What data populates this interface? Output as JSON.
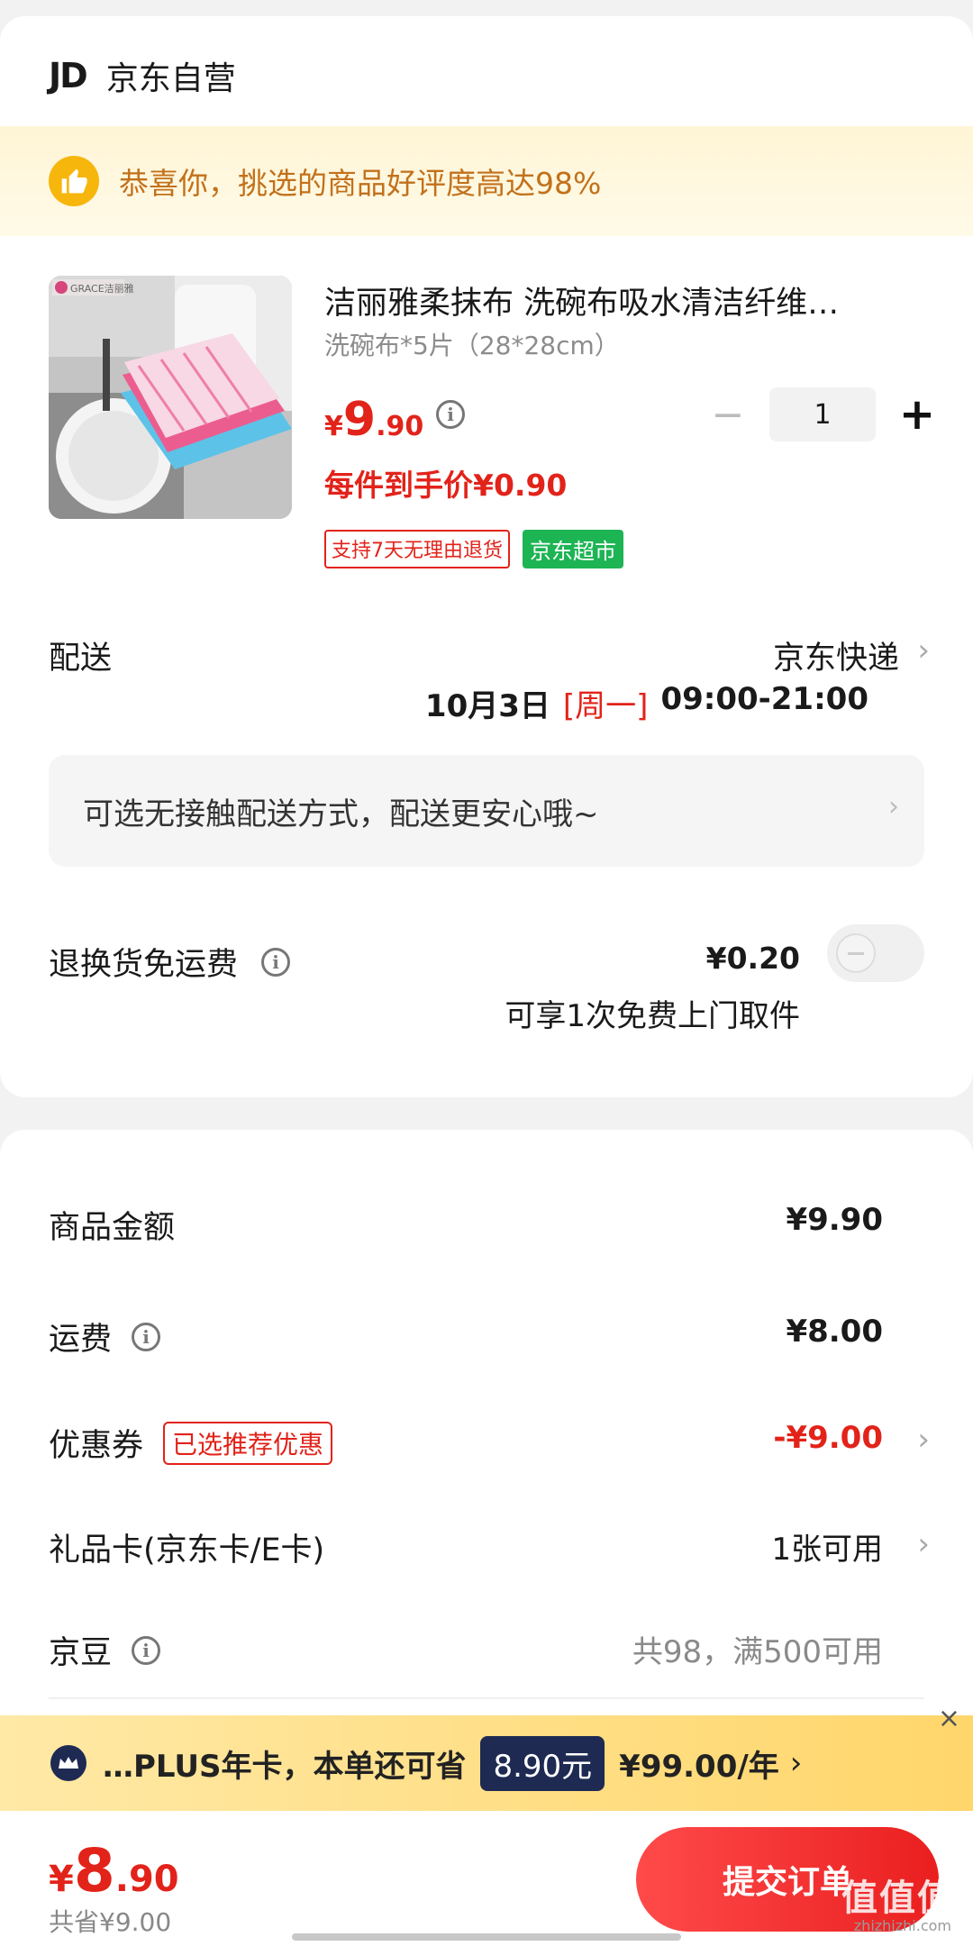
{
  "shop": {
    "logo": "JD",
    "name": "京东自营"
  },
  "praise": {
    "text": "恭喜你，挑选的商品好评度高达98%",
    "icon": "thumbs-up-icon"
  },
  "product": {
    "title": "洁丽雅柔抹布 洗碗布吸水清洁纤维…",
    "spec": "洗碗布*5片（28*28cm）",
    "price_currency": "¥",
    "price_int": "9",
    "price_dec": ".90",
    "unit_price": "每件到手价¥0.90",
    "badges": [
      "支持7天无理由退货",
      "京东超市"
    ],
    "quantity": "1",
    "img_watermark": "GRACE洁丽雅"
  },
  "delivery": {
    "label": "配送",
    "method": "京东快递",
    "date": "10月3日",
    "weekday": "[周一]",
    "time": "09:00-21:00",
    "contactless": "可选无接触配送方式，配送更安心哦~"
  },
  "return_shipping": {
    "label": "退换货免运费",
    "price": "¥0.20",
    "sub": "可享1次免费上门取件",
    "toggle_on": false
  },
  "summary": {
    "goods_amount_label": "商品金额",
    "goods_amount": "¥9.90",
    "freight_label": "运费",
    "freight": "¥8.00",
    "coupon_label": "优惠券",
    "coupon_tag": "已选推荐优惠",
    "coupon_value": "-¥9.00",
    "giftcard_label": "礼品卡(京东卡/E卡)",
    "giftcard_value": "1张可用",
    "jingdou_label": "京豆",
    "jingdou_value": "共98，满500可用"
  },
  "plus": {
    "text": "…PLUS年卡，本单还可省",
    "save": "8.90元",
    "price": "¥99.00/年",
    "chevron": "›",
    "close": "×"
  },
  "bottom": {
    "total_currency": "¥",
    "total_int": "8",
    "total_dec": ".90",
    "saved": "共省¥9.00",
    "submit": "提交订单"
  },
  "watermark": {
    "main": "值值值",
    "sub": "zhizhizhi.com"
  },
  "colors": {
    "accent_red": "#e2231a",
    "plus_navy": "#1e2a52",
    "badge_green": "#1db454"
  }
}
